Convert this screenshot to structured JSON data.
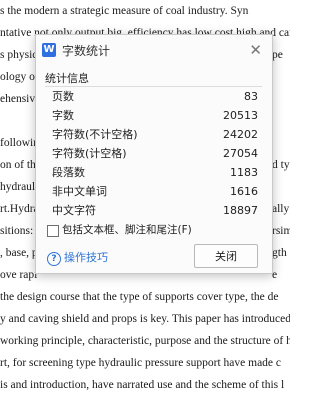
{
  "document": {
    "lines": [
      "s the modern a strategic measure of coal industry. Syn",
      "ntative not only output big, efficiency has low cost high and can al",
      "s physica",
      "ology of c",
      "ehensive",
      "",
      "following",
      "on of the",
      "hydraulic",
      "rt.Hydrau",
      "sitions: T",
      ", base, pi",
      "ove rapi",
      "the design course that the type of supports cover type, the de",
      "y and caving shield and props is key. This paper has introduced requ",
      "working principle, characteristic, purpose and the structure of hy",
      "rt, for screening type hydraulic pressure support have made c",
      "is and introduction, have narrated use and the scheme of this l"
    ],
    "right_fragments": [
      "pe",
      "",
      "",
      "",
      "",
      "",
      "d ty",
      "",
      "ally",
      "rsim",
      "gth is",
      "e"
    ]
  },
  "dialog": {
    "title": "字数统计",
    "logo_letter": "W",
    "close_glyph": "✕",
    "section_title": "统计信息",
    "stats": [
      {
        "label": "页数",
        "value": "83"
      },
      {
        "label": "字数",
        "value": "20513"
      },
      {
        "label": "字符数(不计空格)",
        "value": "24202"
      },
      {
        "label": "字符数(计空格)",
        "value": "27054"
      },
      {
        "label": "段落数",
        "value": "1183"
      },
      {
        "label": "非中文单词",
        "value": "1616"
      },
      {
        "label": "中文字符",
        "value": "18897"
      }
    ],
    "checkbox_label": "包括文本框、脚注和尾注(F)",
    "checkbox_checked": false,
    "tips_label": "操作技巧",
    "tips_icon": "?",
    "close_button": "关闭"
  }
}
